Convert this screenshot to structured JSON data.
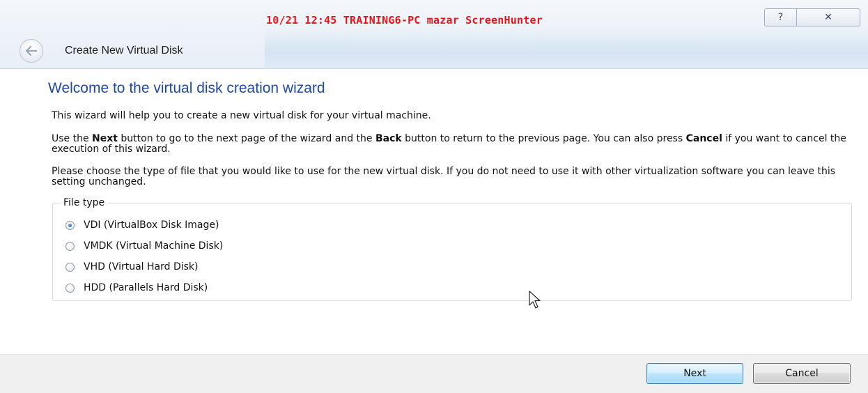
{
  "watermark": "10/21 12:45 TRAINING6-PC mazar ScreenHunter",
  "titlebar": {
    "help_glyph": "?",
    "close_glyph": "✕",
    "back_icon": "back-arrow-icon",
    "title": "Create New Virtual Disk"
  },
  "wizard": {
    "heading": "Welcome to the virtual disk creation wizard",
    "intro": "This wizard will help you to create a new virtual disk for your virtual machine.",
    "nav_help": {
      "t1": "Use the ",
      "b1": "Next",
      "t2": " button to go to the next page of the wizard and the ",
      "b2": "Back",
      "t3": " button to return to the previous page. You can also press ",
      "b3": "Cancel",
      "t4": " if you want to cancel the execution of this wizard."
    },
    "file_type_help": "Please choose the type of file that you would like to use for the new virtual disk. If you do not need to use it with other virtualization software you can leave this setting unchanged.",
    "file_type": {
      "legend": "File type",
      "selected": "VDI (VirtualBox Disk Image)",
      "options": [
        "VDI (VirtualBox Disk Image)",
        "VMDK (Virtual Machine Disk)",
        "VHD (Virtual Hard Disk)",
        "HDD (Parallels Hard Disk)"
      ]
    }
  },
  "footer": {
    "next_label": "Next",
    "cancel_label": "Cancel"
  },
  "colors": {
    "heading": "#1f4aa8",
    "watermark": "#e8141b",
    "radio_checked": "#1d5fb6"
  }
}
